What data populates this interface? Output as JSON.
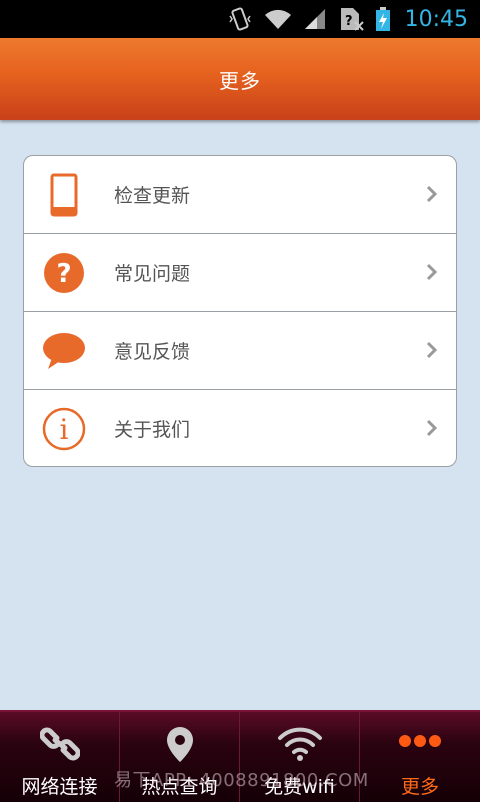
{
  "status_bar": {
    "time": "10:45",
    "icons": [
      "vibrate-icon",
      "wifi-icon",
      "signal-icon",
      "no-sim-icon",
      "battery-charging-icon"
    ]
  },
  "header": {
    "title": "更多"
  },
  "menu": {
    "items": [
      {
        "label": "检查更新",
        "icon": "phone-icon"
      },
      {
        "label": "常见问题",
        "icon": "question-icon"
      },
      {
        "label": "意见反馈",
        "icon": "chat-bubble-icon"
      },
      {
        "label": "关于我们",
        "icon": "info-icon"
      }
    ]
  },
  "tabs": [
    {
      "label": "网络连接",
      "icon": "link-icon",
      "active": false
    },
    {
      "label": "热点查询",
      "icon": "location-pin-icon",
      "active": false
    },
    {
      "label": "免费wifi",
      "icon": "wifi-icon",
      "active": false
    },
    {
      "label": "更多",
      "icon": "more-dots-icon",
      "active": true
    }
  ],
  "watermark": "易下APP: 4008891800.COM",
  "colors": {
    "accent": "#e86a2a",
    "background": "#d5e2f0",
    "tab_active": "#ff6a1a"
  }
}
